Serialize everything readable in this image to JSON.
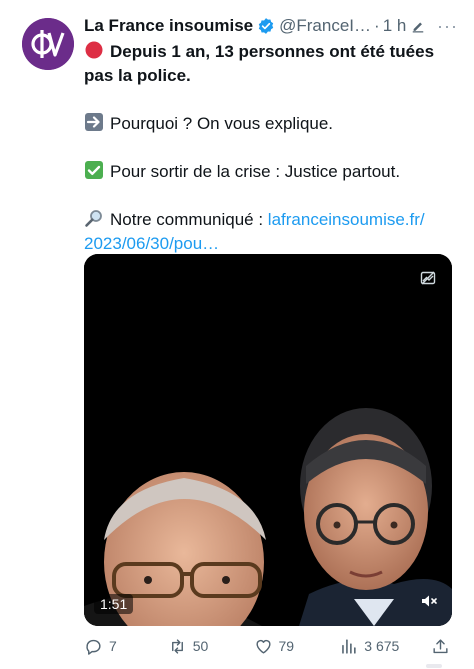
{
  "author": {
    "name": "La France insoumise",
    "handle": "@FranceI…",
    "time": "1 h",
    "separator": "·",
    "more": "···"
  },
  "tweet": {
    "line1": "Depuis 1 an, 13 personnes ont été tuées",
    "line2": "pas la police.",
    "line3": "Pourquoi ? On vous explique.",
    "line4": "Pour sortir de la crise : Justice partout.",
    "line5_prefix": "Notre communiqué : ",
    "link_part1": "lafranceinsoumise.fr/",
    "link_part2": "2023/06/30/pou…"
  },
  "media": {
    "duration": "1:51"
  },
  "actions": {
    "replies": "7",
    "retweets": "50",
    "likes": "79",
    "views": "3 675"
  },
  "icons": {
    "reply": "reply-icon",
    "retweet": "retweet-icon",
    "like": "heart-icon",
    "views": "views-icon",
    "share": "share-icon"
  },
  "colors": {
    "text": "#0f1419",
    "secondary": "#536471",
    "link": "#1d9bf0",
    "avatar": "#6b2c8a",
    "verified": "#1d9bf0"
  }
}
